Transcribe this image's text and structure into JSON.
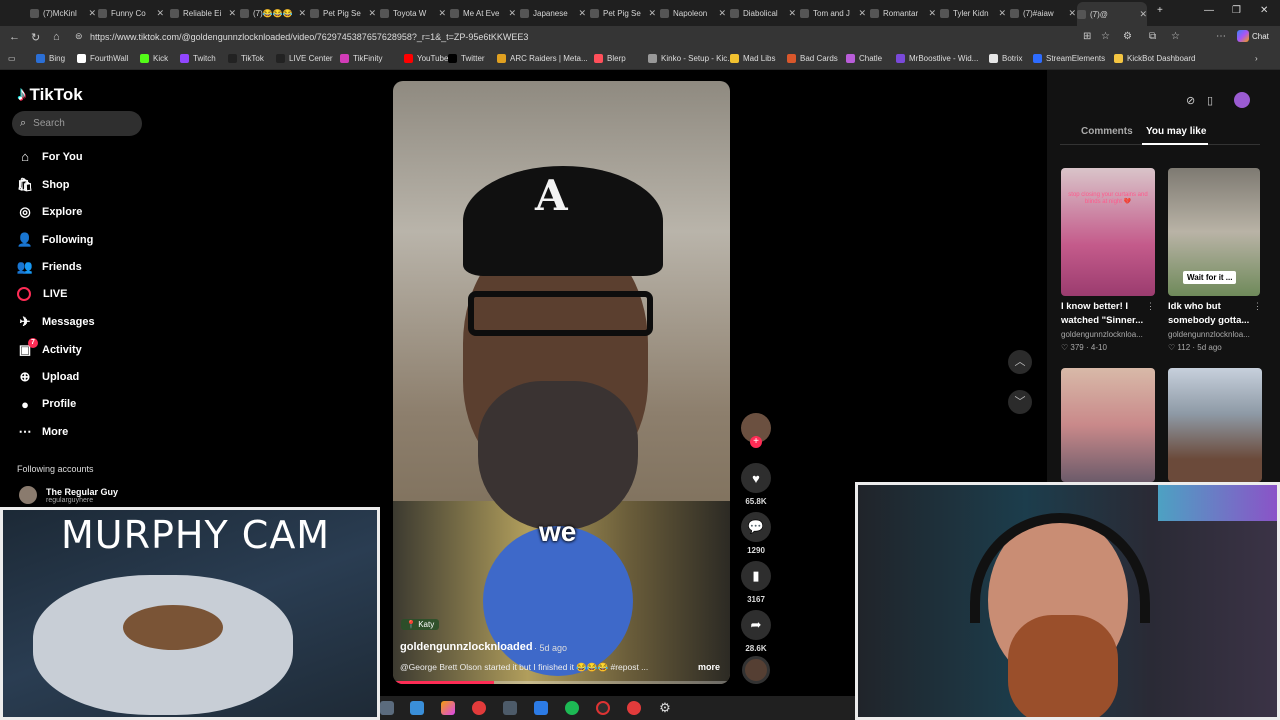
{
  "browser": {
    "tabs": [
      {
        "title": "(7)McKinl",
        "active": false
      },
      {
        "title": "Funny Co",
        "active": false
      },
      {
        "title": "Reliable Ei",
        "active": false
      },
      {
        "title": "(7)😂😂😂",
        "active": false
      },
      {
        "title": "Pet Pig Se",
        "active": false
      },
      {
        "title": "Toyota W",
        "active": false
      },
      {
        "title": "Me At Eve",
        "active": false
      },
      {
        "title": "Japanese",
        "active": false
      },
      {
        "title": "Pet Pig Se",
        "active": false
      },
      {
        "title": "Napoleon",
        "active": false
      },
      {
        "title": "Diabolical",
        "active": false
      },
      {
        "title": "Tom and J",
        "active": false
      },
      {
        "title": "Romantar",
        "active": false
      },
      {
        "title": "Tyler Kidn",
        "active": false
      },
      {
        "title": "(7)#aiaw",
        "active": false
      },
      {
        "title": "(7)@",
        "active": true
      }
    ],
    "new_tab": "+",
    "url": "https://www.tiktok.com/@goldengunnzlocknloaded/video/7629745387657628958?_r=1&_t=ZP-95e6tKKWEE3",
    "copilot_label": "Chat",
    "bookmarks": [
      {
        "label": "Bing",
        "color": "#2b6fd6"
      },
      {
        "label": "FourthWall",
        "color": "#ffffff"
      },
      {
        "label": "Kick",
        "color": "#53fc18"
      },
      {
        "label": "Twitch",
        "color": "#9146ff"
      },
      {
        "label": "TikTok",
        "color": "#222222"
      },
      {
        "label": "LIVE Center",
        "color": "#222222"
      },
      {
        "label": "TikFinity",
        "color": "#d23cb8"
      },
      {
        "label": "YouTube",
        "color": "#ff0000"
      },
      {
        "label": "Twitter",
        "color": "#000000"
      },
      {
        "label": "ARC Raiders | Meta...",
        "color": "#e0a020"
      },
      {
        "label": "Blerp",
        "color": "#ff4f5a"
      },
      {
        "label": "Kinko - Setup - Kic...",
        "color": "#999999"
      },
      {
        "label": "Mad Libs",
        "color": "#f2c230"
      },
      {
        "label": "Bad Cards",
        "color": "#d9572b"
      },
      {
        "label": "Chatle",
        "color": "#b95dd9"
      },
      {
        "label": "MrBoostlive - Wid...",
        "color": "#7a49d9"
      },
      {
        "label": "Botrix",
        "color": "#e6e6e6"
      },
      {
        "label": "StreamElements",
        "color": "#2e6cff"
      },
      {
        "label": "KickBot Dashboard",
        "color": "#f4c542"
      }
    ]
  },
  "tiktok": {
    "brand": "TikTok",
    "search_placeholder": "Search",
    "nav": [
      {
        "label": "For You",
        "icon": "home-icon"
      },
      {
        "label": "Shop",
        "icon": "shop-icon"
      },
      {
        "label": "Explore",
        "icon": "compass-icon"
      },
      {
        "label": "Following",
        "icon": "following-icon"
      },
      {
        "label": "Friends",
        "icon": "friends-icon"
      },
      {
        "label": "LIVE",
        "icon": "live-icon"
      },
      {
        "label": "Messages",
        "icon": "messages-icon"
      },
      {
        "label": "Activity",
        "icon": "activity-icon"
      },
      {
        "label": "Upload",
        "icon": "upload-icon"
      },
      {
        "label": "Profile",
        "icon": "profile-icon"
      },
      {
        "label": "More",
        "icon": "more-icon"
      }
    ],
    "activity_badge": "7",
    "following_heading": "Following accounts",
    "following_account": {
      "name": "The Regular Guy",
      "handle": "regularguyhere"
    },
    "video": {
      "caption_word": "we",
      "location_tag": "Katy",
      "author": "goldengunnzlocknloaded",
      "age": "· 5d ago",
      "description": "@George Brett Olson started it but I finished it 😂😂😂 #repost ...",
      "more": "more",
      "progress": 0.3
    },
    "actions": [
      {
        "name": "like",
        "count": "65.8K"
      },
      {
        "name": "comment",
        "count": "1290"
      },
      {
        "name": "save",
        "count": "3167"
      },
      {
        "name": "share",
        "count": "28.6K"
      }
    ],
    "right_panel": {
      "tabs": [
        {
          "label": "Comments",
          "active": false
        },
        {
          "label": "You may like",
          "active": true
        }
      ],
      "cards": [
        {
          "title": "I know better! I watched \"Sinner...",
          "channel": "goldengunnzlocknloa...",
          "likes": "379",
          "date": "4-10",
          "overlay": "stop closing your curtains and blinds at night 💔"
        },
        {
          "title": "Idk who but somebody gotta...",
          "channel": "goldengunnzlocknloa...",
          "likes": "112",
          "date": "5d ago",
          "overlay": "Wait for it ..."
        }
      ]
    }
  },
  "cams": {
    "murphy_title": "MURPHY CAM"
  }
}
